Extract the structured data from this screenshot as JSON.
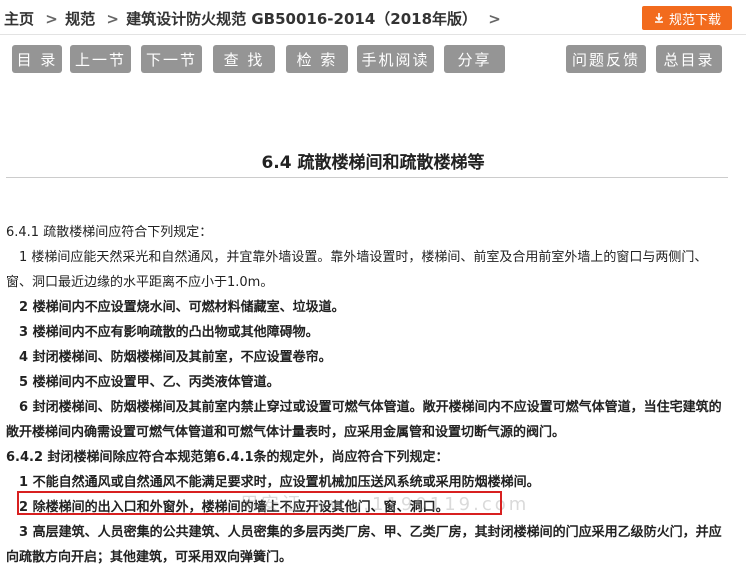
{
  "breadcrumb": {
    "home": "主页",
    "sep": ">",
    "section": "规范",
    "doc": "建筑设计防火规范 GB50016-2014（2018年版）"
  },
  "download": {
    "label": "规范下载",
    "icon": "download-icon"
  },
  "toolbar": {
    "catalog": "目 录",
    "prev": "上一节",
    "next": "下一节",
    "find": "查 找",
    "search": "检 索",
    "mobile": "手机阅读",
    "share": "分享",
    "feedback": "问题反馈",
    "toc": "总目录"
  },
  "title": "6.4 疏散楼梯间和疏散楼梯等",
  "content": {
    "p1": "6.4.1 疏散楼梯间应符合下列规定：",
    "p2": "1 楼梯间应能天然采光和自然通风，并宜靠外墙设置。靠外墙设置时，楼梯间、前室及合用前室外墙上的窗口与两侧门、窗、洞口最近边缘的水平距离不应小于1.0m。",
    "p3": "2 楼梯间内不应设置烧水间、可燃材料储藏室、垃圾道。",
    "p4": "3 楼梯间内不应有影响疏散的凸出物或其他障碍物。",
    "p5": "4 封闭楼梯间、防烟楼梯间及其前室，不应设置卷帘。",
    "p6": "5 楼梯间内不应设置甲、乙、丙类液体管道。",
    "p7": "6 封闭楼梯间、防烟楼梯间及其前室内禁止穿过或设置可燃气体管道。敞开楼梯间内不应设置可燃气体管道，当住宅建筑的敞开楼梯间内确需设置可燃气体管道和可燃气体计量表时，应采用金属管和设置切断气源的阀门。",
    "p8": "6.4.2 封闭楼梯间除应符合本规范第6.4.1条的规定外，尚应符合下列规定：",
    "p9": "1 不能自然通风或自然通风不能满足要求时，应设置机械加压送风系统或采用防烟楼梯间。",
    "p10": "2 除楼梯间的出入口和外窗外，楼梯间的墙上不应开设其他门、窗、洞口。",
    "p11": "3 高层建筑、人员密集的公共建筑、人员密集的多层丙类厂房、甲、乙类厂房，其封闭楼梯间的门应采用乙级防火门，并应向疏散方向开启；其他建筑，可采用双向弹簧门。"
  },
  "watermark": "用安证 www.1190119.com",
  "colors": {
    "accent": "#f26b1d",
    "button": "#959595",
    "highlight": "#d82020"
  }
}
